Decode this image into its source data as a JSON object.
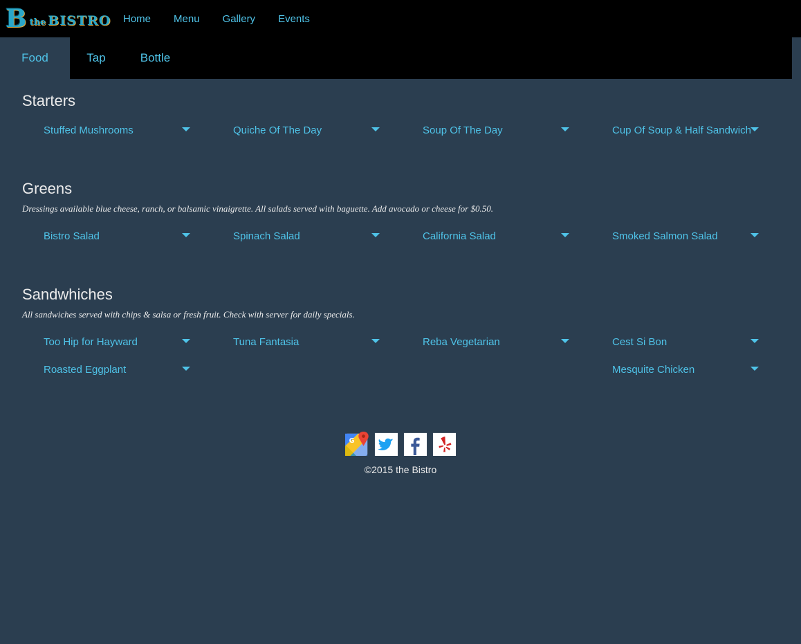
{
  "brand": {
    "logo_letter": "B",
    "logo_small": "the",
    "logo_name": "BISTRO"
  },
  "nav": [
    "Home",
    "Menu",
    "Gallery",
    "Events"
  ],
  "tabs": [
    "Food",
    "Tap",
    "Bottle"
  ],
  "sections": {
    "starters": {
      "title": "Starters",
      "items": [
        "Stuffed Mushrooms",
        "Quiche Of The Day",
        "Soup Of The Day",
        "Cup Of Soup & Half Sandwich"
      ]
    },
    "greens": {
      "title": "Greens",
      "note": "Dressings available blue cheese, ranch, or balsamic vinaigrette. All salads served with baguette. Add avocado or cheese for $0.50.",
      "items": [
        "Bistro Salad",
        "Spinach Salad",
        "California Salad",
        "Smoked Salmon Salad"
      ]
    },
    "sandwiches": {
      "title": "Sandwhiches",
      "note": "All sandwiches served with chips & salsa or fresh fruit. Check with server for daily specials.",
      "items": [
        "Too Hip for Hayward",
        "Tuna Fantasia",
        "Reba Vegetarian",
        "Cest Si Bon",
        "Roasted Eggplant",
        "Mesquite Chicken"
      ]
    }
  },
  "footer": {
    "icons": [
      "google-maps-icon",
      "twitter-icon",
      "facebook-icon",
      "yelp-icon"
    ],
    "copyright": "©2015 the Bistro"
  },
  "colors": {
    "background": "#2b3e50",
    "bar": "#000000",
    "link": "#4fc3e8",
    "text": "#ebebeb"
  }
}
